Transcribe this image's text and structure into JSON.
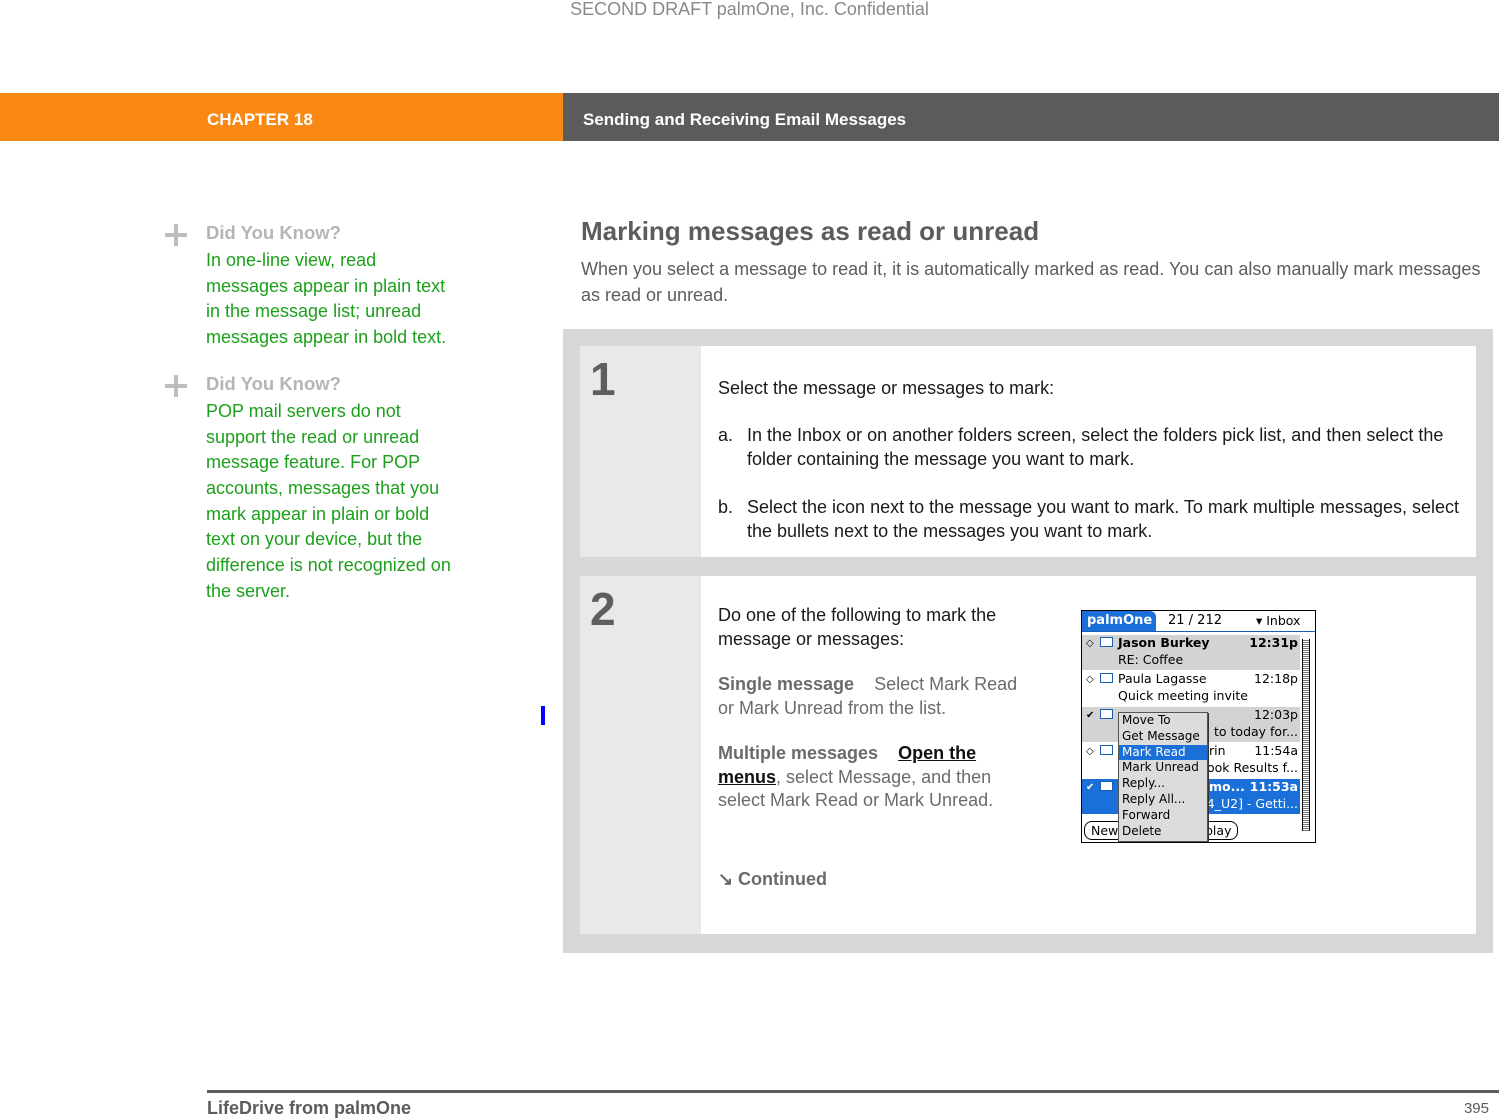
{
  "watermark": "SECOND DRAFT palmOne, Inc.  Confidential",
  "header": {
    "chapter": "CHAPTER 18",
    "title": "Sending and Receiving Email Messages",
    "colors": {
      "chapter_bg": "#f98913",
      "title_bg": "#5b5b5b"
    }
  },
  "sidebar": [
    {
      "heading": "Did You Know?",
      "text": "In one-line view, read messages appear in plain text in the message list; unread messages appear in bold text."
    },
    {
      "heading": "Did You Know?",
      "text": "POP mail servers do not support the read or unread message feature. For POP accounts, messages that you mark appear in plain or bold text on your device, but the difference is not recognized on the server."
    }
  ],
  "section": {
    "title": "Marking messages as read or unread",
    "intro": "When you select a message to read it, it is automatically marked as read. You can also manually mark messages as read or unread."
  },
  "steps": [
    {
      "number": "1",
      "lead": "Select the message or messages to mark:",
      "items": [
        {
          "label": "a.",
          "text": "In the Inbox or on another folders screen, select the folders pick list, and then select the folder containing the message you want to mark."
        },
        {
          "label": "b.",
          "text": "Select the icon next to the message you want to mark. To mark multiple messages, select the bullets next to the messages you want to mark."
        }
      ]
    },
    {
      "number": "2",
      "lead": "Do one of the following to mark the message or messages:",
      "single": {
        "term": "Single message",
        "text": "Select Mark Read or Mark Unread from the list."
      },
      "multiple": {
        "term": "Multiple messages",
        "link": "Open the menus",
        "text": ", select Message, and then select Mark Read or Mark Unread."
      },
      "continued": "Continued"
    }
  ],
  "device": {
    "brand": "palmOne",
    "count": "21 / 212",
    "folder": "Inbox",
    "messages": [
      {
        "from": "Jason Burkey",
        "time": "12:31p",
        "subject": "RE: Coffee",
        "unread": true,
        "checked": false
      },
      {
        "from": "Paula Lagasse",
        "time": "12:18p",
        "subject": "Quick meeting invite",
        "unread": false,
        "checked": false
      },
      {
        "from": "",
        "time": "12:03p",
        "subject": "to today for...",
        "unread": false,
        "checked": true
      },
      {
        "from": "rin",
        "time": "11:54a",
        "subject": "Look Results f...",
        "unread": false,
        "checked": false
      },
      {
        "from": "mo...",
        "time": "11:53a",
        "subject": "4_U2] - Getti...",
        "unread": true,
        "checked": true
      }
    ],
    "menu": [
      "Move To",
      "Get Message",
      "Mark Read",
      "Mark Unread",
      "Reply...",
      "Reply All...",
      "Forward",
      "Delete"
    ],
    "menu_selected": "Mark Read",
    "buttons": [
      "New",
      "play"
    ]
  },
  "footer": {
    "book": "LifeDrive from palmOne",
    "page": "395"
  }
}
